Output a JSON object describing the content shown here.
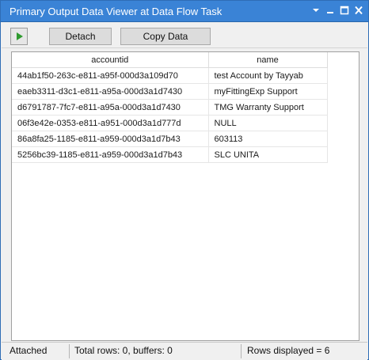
{
  "window": {
    "title": "Primary Output Data Viewer at Data Flow Task"
  },
  "title_controls": {
    "dropdown_icon": "chevron-down-icon",
    "minimize_icon": "minimize-icon",
    "maximize_icon": "maximize-icon",
    "close_icon": "close-icon"
  },
  "toolbar": {
    "play_icon": "play-icon",
    "detach_label": "Detach",
    "copy_label": "Copy Data"
  },
  "grid": {
    "columns": [
      "accountid",
      "name"
    ],
    "rows": [
      [
        "44ab1f50-263c-e811-a95f-000d3a109d70",
        "test Account by Tayyab"
      ],
      [
        "eaeb3311-d3c1-e811-a95a-000d3a1d7430",
        "myFittingExp Support"
      ],
      [
        "d6791787-7fc7-e811-a95a-000d3a1d7430",
        "TMG Warranty Support"
      ],
      [
        "06f3e42e-0353-e811-a951-000d3a1d777d",
        "NULL"
      ],
      [
        "86a8fa25-1185-e811-a959-000d3a1d7b43",
        "603113"
      ],
      [
        "5256bc39-1185-e811-a959-000d3a1d7b43",
        "SLC UNITA"
      ]
    ]
  },
  "status": {
    "state": "Attached",
    "totals": "Total rows: 0, buffers: 0",
    "rows_displayed": "Rows displayed = 6"
  },
  "colors": {
    "titlebar": "#3a83d6",
    "play_green": "#2e9a2e"
  }
}
